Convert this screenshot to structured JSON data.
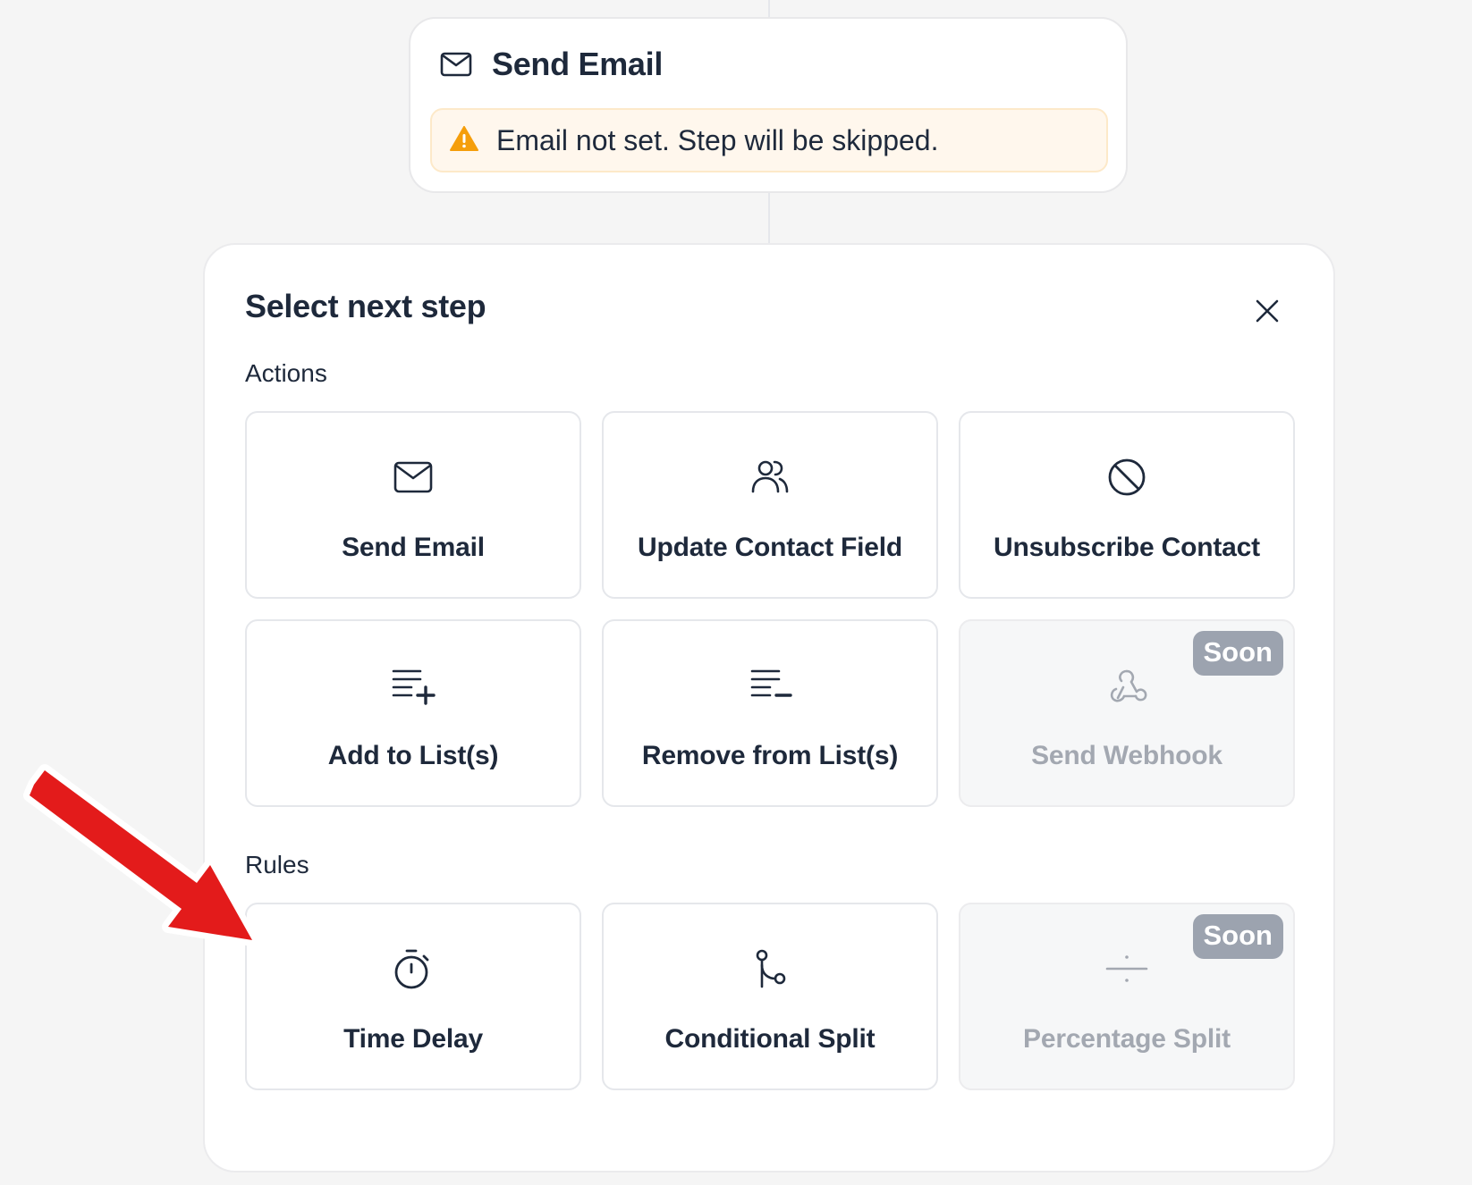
{
  "email_node": {
    "icon": "mail-icon",
    "title": "Send Email",
    "warning_icon": "warning-triangle-icon",
    "warning_text": "Email not set. Step will be skipped."
  },
  "panel": {
    "title": "Select next step",
    "close_icon": "close-icon",
    "sections": {
      "actions": {
        "label": "Actions",
        "items": [
          {
            "label": "Send Email",
            "icon": "mail-icon"
          },
          {
            "label": "Update Contact Field",
            "icon": "users-icon"
          },
          {
            "label": "Unsubscribe Contact",
            "icon": "ban-icon"
          },
          {
            "label": "Add to List(s)",
            "icon": "list-plus-icon"
          },
          {
            "label": "Remove from List(s)",
            "icon": "list-minus-icon"
          },
          {
            "label": "Send Webhook",
            "icon": "webhook-icon",
            "badge": "Soon",
            "disabled": true
          }
        ]
      },
      "rules": {
        "label": "Rules",
        "items": [
          {
            "label": "Time Delay",
            "icon": "timer-icon"
          },
          {
            "label": "Conditional Split",
            "icon": "split-icon"
          },
          {
            "label": "Percentage Split",
            "icon": "divide-icon",
            "badge": "Soon",
            "disabled": true
          }
        ]
      }
    }
  },
  "colors": {
    "background": "#f5f5f5",
    "text": "#1e293b",
    "warning_bg": "#fff7ed",
    "warning_icon": "#f59e0b",
    "badge_bg": "#9ca3af",
    "arrow": "#e31b1b"
  },
  "annotation": {
    "icon": "red-arrow-icon"
  }
}
